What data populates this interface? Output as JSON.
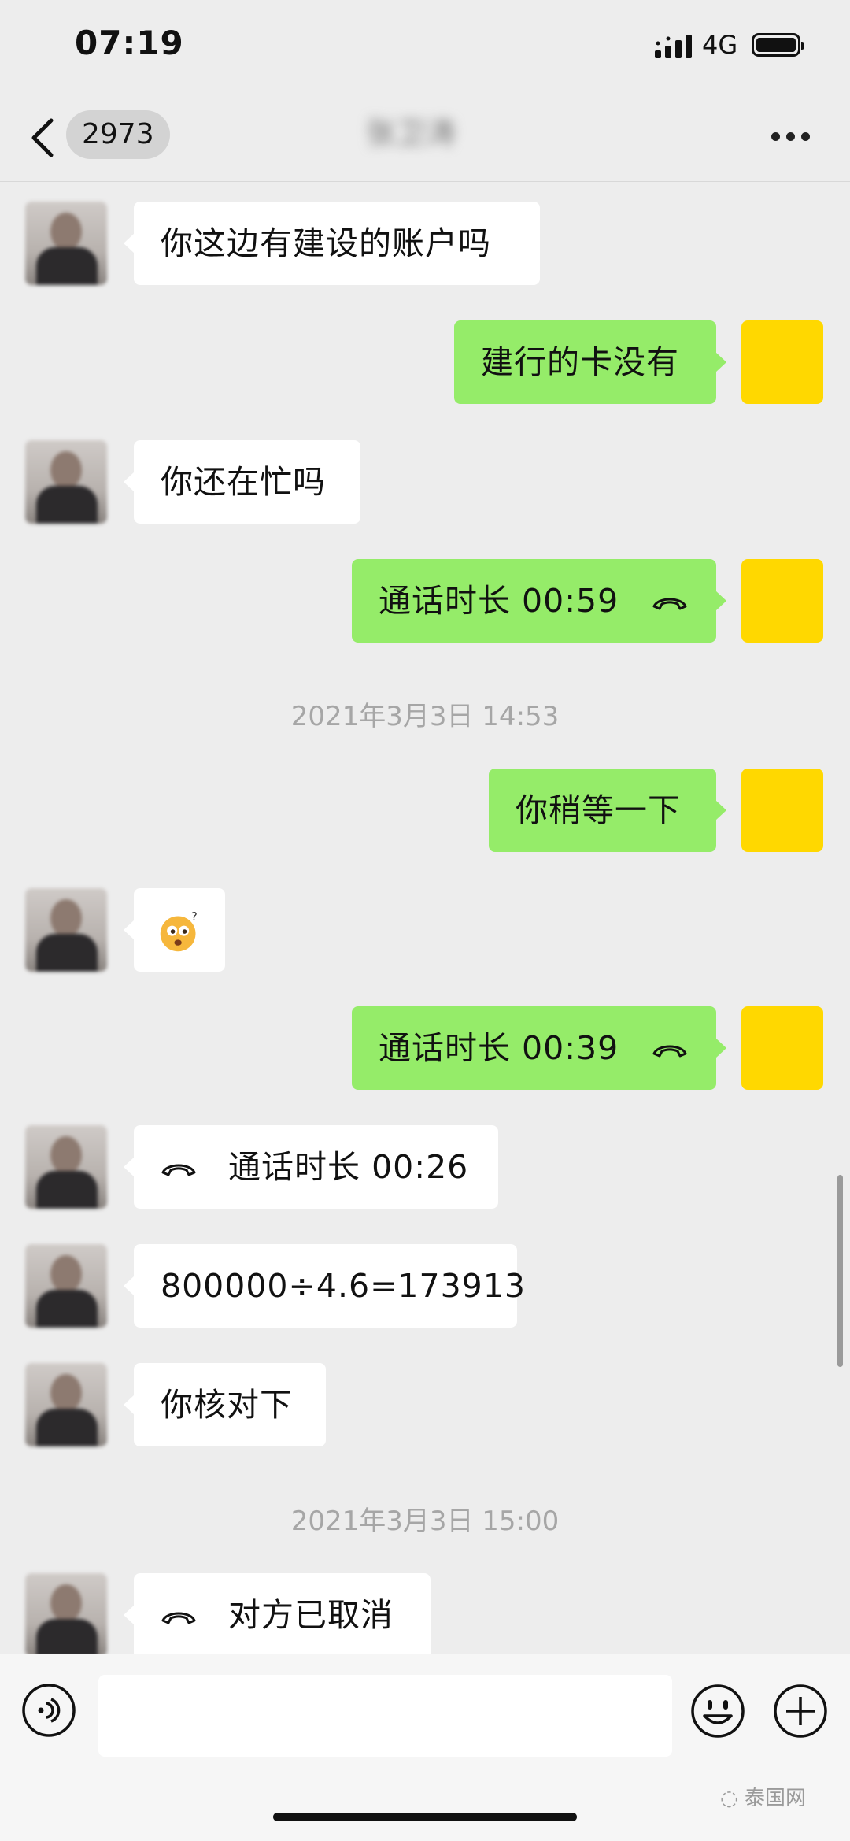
{
  "status_bar": {
    "time": "07:19",
    "network": "4G"
  },
  "nav": {
    "back_count": "2973",
    "contact_name": "张卫涛"
  },
  "messages": [
    {
      "side": "left",
      "text": "你这边有建设的账户吗"
    },
    {
      "side": "right",
      "text": "建行的卡没有"
    },
    {
      "side": "left",
      "text": "你还在忙吗"
    },
    {
      "side": "right",
      "text": "通话时长 00:59",
      "icon": "phone-hangup-icon"
    },
    {
      "side": "right",
      "text": "你稍等一下"
    },
    {
      "side": "left",
      "icon": "confused-face-emoji"
    },
    {
      "side": "right",
      "text": "通话时长 00:39",
      "icon": "phone-hangup-icon"
    },
    {
      "side": "left",
      "text": "通话时长 00:26",
      "icon": "phone-hangup-icon"
    },
    {
      "side": "left",
      "text": "800000÷4.6=173913"
    },
    {
      "side": "left",
      "text": "你核对下"
    },
    {
      "side": "left",
      "text": "对方已取消",
      "icon": "phone-hangup-icon"
    }
  ],
  "timestamps": [
    "2021年3月3日 14:53",
    "2021年3月3日 15:00"
  ],
  "watermark": "泰国网",
  "colors": {
    "self_bubble": "#95ec69",
    "other_bubble": "#ffffff",
    "self_avatar": "#ffd800",
    "background": "#ededed"
  }
}
